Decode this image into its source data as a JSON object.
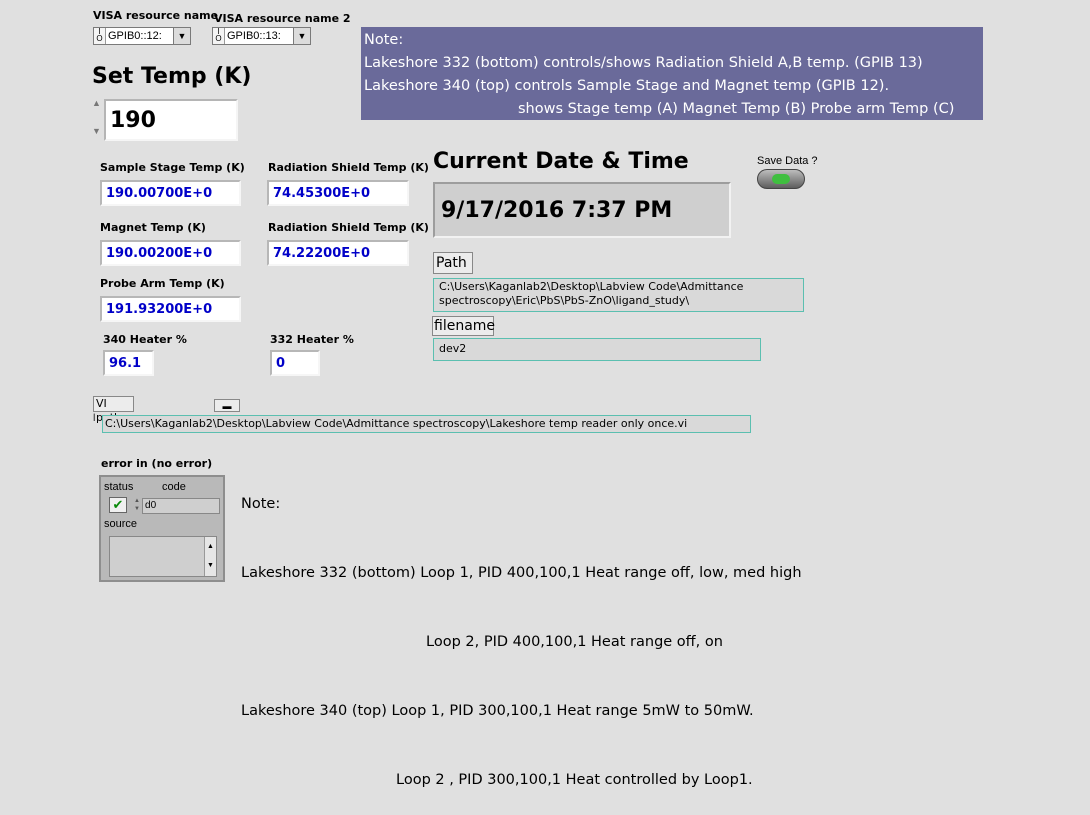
{
  "visa1": {
    "label": "VISA resource name",
    "value": "GPIB0::12:",
    "prefix": "I/O"
  },
  "visa2": {
    "label": "VISA resource name 2",
    "value": "GPIB0::13:",
    "prefix": "I/O"
  },
  "note_top": {
    "title": "Note:",
    "line1": "Lakeshore 332 (bottom) controls/shows Radiation Shield A,B temp. (GPIB 13)",
    "line2": "Lakeshore 340 (top) controls Sample Stage and Magnet temp (GPIB 12).",
    "line3": "shows Stage temp (A) Magnet Temp (B) Probe arm Temp (C)"
  },
  "set_temp": {
    "label": "Set Temp (K)",
    "value": "190"
  },
  "readings": {
    "sample_stage": {
      "label": "Sample Stage Temp (K)",
      "value": "190.00700E+0"
    },
    "rad_shield_a": {
      "label": "Radiation Shield Temp (K)",
      "value": "74.45300E+0"
    },
    "magnet": {
      "label": "Magnet Temp (K)",
      "value": "190.00200E+0"
    },
    "rad_shield_b": {
      "label": "Radiation Shield Temp (K)",
      "value": "74.22200E+0"
    },
    "probe_arm": {
      "label": "Probe Arm Temp (K)",
      "value": "191.93200E+0"
    },
    "heater_340": {
      "label": "340 Heater %",
      "value": "96.1"
    },
    "heater_332": {
      "label": "332 Heater %",
      "value": "0"
    }
  },
  "datetime": {
    "label": "Current Date & Time",
    "value": "9/17/2016 7:37 PM"
  },
  "save": {
    "label": "Save Data ?",
    "led_color": "#3fbf3f"
  },
  "path": {
    "label": "Path",
    "value_line1": "C:\\Users\\Kaganlab2\\Desktop\\Labview Code\\Admittance",
    "value_line2": "spectroscopy\\Eric\\PbS\\PbS-ZnO\\ligand_study\\"
  },
  "filename": {
    "label": "filename",
    "value": "dev2"
  },
  "vi_path": {
    "label": "VI path",
    "value": "C:\\Users\\Kaganlab2\\Desktop\\Labview Code\\Admittance spectroscopy\\Lakeshore temp reader only once.vi"
  },
  "error_in": {
    "label": "error in (no error)",
    "status_label": "status",
    "code_label": "code",
    "code_value": "0",
    "code_prefix": "d",
    "source_label": "source"
  },
  "note_bottom": {
    "title": "Note:",
    "line1": "Lakeshore 332 (bottom) Loop 1, PID 400,100,1 Heat range off, low, med high",
    "line2": "Loop 2, PID 400,100,1 Heat range off, on",
    "line3": "Lakeshore 340 (top) Loop 1, PID 300,100,1 Heat range 5mW to 50mW.",
    "line4": "Loop 2 , PID 300,100,1 Heat controlled by Loop1."
  },
  "colors": {
    "background": "#e0e0e0",
    "note_box": "#6a6a9a",
    "numeric_text": "#0000c8",
    "path_border": "#5bbfb0"
  }
}
